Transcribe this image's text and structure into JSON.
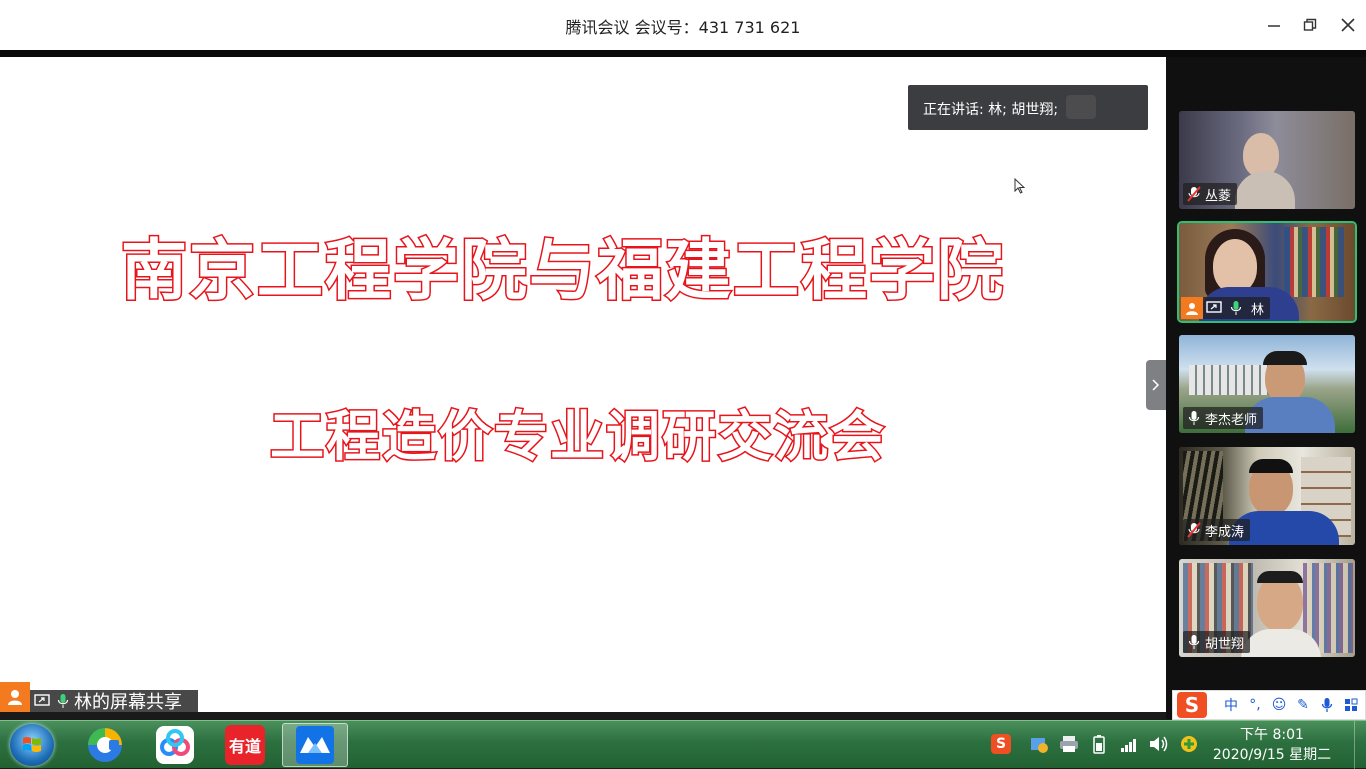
{
  "window": {
    "title": "腾讯会议 会议号：431 731 621",
    "minimize_icon": "minimize-icon",
    "maximize_icon": "restore-icon",
    "close_icon": "close-icon"
  },
  "share": {
    "slide_line1": "南京工程学院与福建工程学院",
    "slide_line2": "工程造价专业调研交流会",
    "speaking_text": "正在讲话: 林; 胡世翔;",
    "share_label": "林的屏幕共享",
    "slide_text_color": "#e8141b"
  },
  "participants": [
    {
      "name": "丛菱",
      "mic": "muted",
      "active": false
    },
    {
      "name": "林",
      "mic": "on",
      "active": true,
      "host": true,
      "sharing": true
    },
    {
      "name": "李杰老师",
      "mic": "on",
      "active": false
    },
    {
      "name": "李成涛",
      "mic": "muted",
      "active": false
    },
    {
      "name": "胡世翔",
      "mic": "on",
      "active": false
    }
  ],
  "ime": {
    "items": [
      "中",
      "°,",
      "☺",
      "✎",
      "🎤",
      "▦"
    ]
  },
  "taskbar": {
    "apps": [
      "chrome-like-icon",
      "baidu-netdisk-icon",
      "youdao-icon",
      "tencent-meeting-icon"
    ],
    "youdao_label": "有道",
    "clock_time": "下午 8:01",
    "clock_date": "2020/9/15 星期二"
  }
}
